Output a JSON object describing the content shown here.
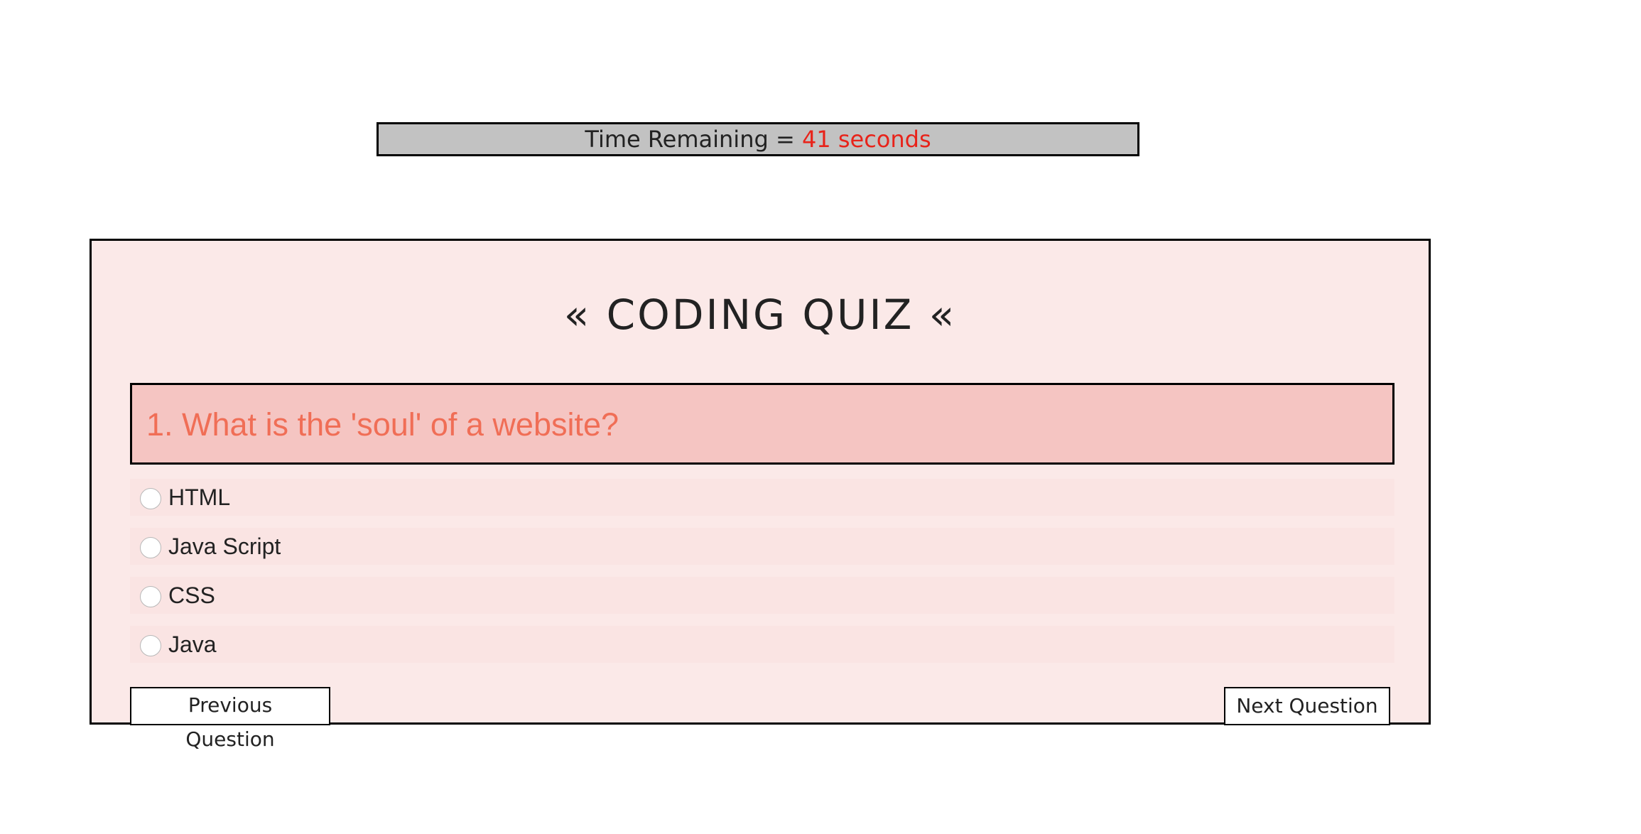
{
  "timer": {
    "label": "Time Remaining = ",
    "value": "41 seconds",
    "value_color": "#e8231a"
  },
  "quiz": {
    "title": "« CODING QUIZ «",
    "question": "1. What is the 'soul' of a website?",
    "options": [
      {
        "label": "HTML",
        "selected": false
      },
      {
        "label": "Java Script",
        "selected": false
      },
      {
        "label": "CSS",
        "selected": false
      },
      {
        "label": "Java",
        "selected": false
      }
    ],
    "prev_label": "Previous Question",
    "next_label": "Next Question"
  },
  "colors": {
    "quiz_background": "#fbe9e8",
    "question_background": "#f5c5c2",
    "question_text": "#f06e56",
    "timer_background": "#c2c2c2"
  }
}
